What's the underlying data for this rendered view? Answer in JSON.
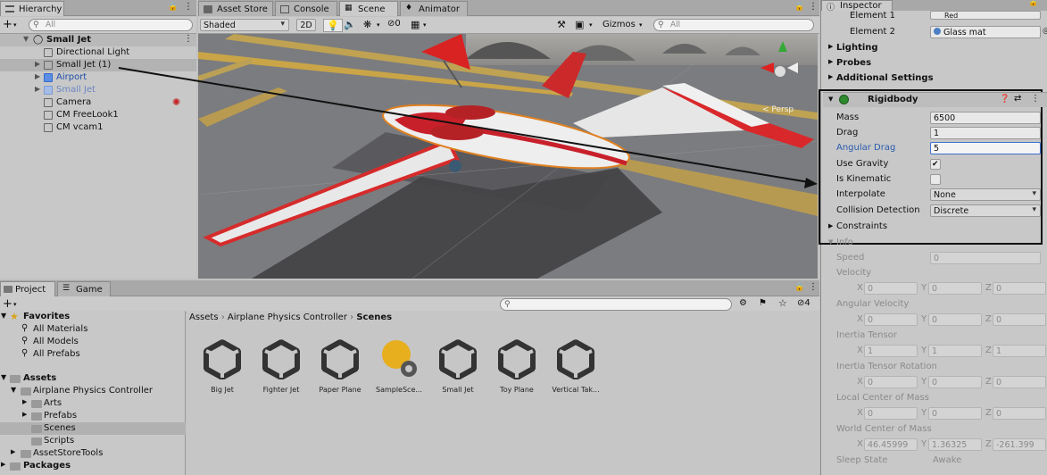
{
  "hierarchy": {
    "tab": "Hierarchy",
    "search_placeholder": "All",
    "add": "+",
    "root": "Small Jet",
    "items": [
      {
        "label": "Directional Light"
      },
      {
        "label": "Small Jet (1)"
      },
      {
        "label": "Airport"
      },
      {
        "label": "Small Jet"
      },
      {
        "label": "Camera"
      },
      {
        "label": "CM FreeLook1"
      },
      {
        "label": "CM vcam1"
      }
    ]
  },
  "scene_tabs": {
    "asset_store": "Asset Store",
    "console": "Console",
    "scene": "Scene",
    "animator": "Animator"
  },
  "scene_toolbar": {
    "shading": "Shaded",
    "mode_2d": "2D",
    "fx_count": "0",
    "gizmos": "Gizmos",
    "search_placeholder": "All",
    "persp": "< Persp"
  },
  "project": {
    "tab_project": "Project",
    "tab_game": "Game",
    "add": "+",
    "hidden_count": "4",
    "breadcrumb": [
      "Assets",
      "Airplane Physics Controller",
      "Scenes"
    ],
    "favorites": {
      "label": "Favorites",
      "items": [
        "All Materials",
        "All Models",
        "All Prefabs"
      ]
    },
    "assets": {
      "label": "Assets",
      "child": "Airplane Physics Controller",
      "folders": [
        "Arts",
        "Prefabs",
        "Scenes",
        "Scripts"
      ],
      "other": "AssetStoreTools"
    },
    "packages": "Packages",
    "files": [
      "Big Jet",
      "Fighter Jet",
      "Paper Plane",
      "SampleSce...",
      "Small Jet",
      "Toy Plane",
      "Vertical Tak..."
    ]
  },
  "inspector": {
    "tab": "Inspector",
    "element1_label": "Element 1",
    "element1_value": "Red",
    "element2_label": "Element 2",
    "element2_value": "Glass mat",
    "sections": [
      "Lighting",
      "Probes",
      "Additional Settings"
    ],
    "rigidbody": {
      "title": "Rigidbody",
      "mass_label": "Mass",
      "mass": "6500",
      "drag_label": "Drag",
      "drag": "1",
      "angular_drag_label": "Angular Drag",
      "angular_drag": "5",
      "use_gravity_label": "Use Gravity",
      "use_gravity": "✔",
      "is_kinematic_label": "Is Kinematic",
      "interpolate_label": "Interpolate",
      "interpolate": "None",
      "collision_label": "Collision Detection",
      "collision": "Discrete",
      "constraints_label": "Constraints"
    },
    "info": {
      "label": "Info",
      "speed_label": "Speed",
      "speed": "0",
      "velocity_label": "Velocity",
      "velocity": [
        "0",
        "0",
        "0"
      ],
      "angular_velocity_label": "Angular Velocity",
      "angular_velocity": [
        "0",
        "0",
        "0"
      ],
      "inertia_tensor_label": "Inertia Tensor",
      "inertia_tensor": [
        "1",
        "1",
        "1"
      ],
      "inertia_rotation_label": "Inertia Tensor Rotation",
      "inertia_rotation": [
        "0",
        "0",
        "0"
      ],
      "local_com_label": "Local Center of Mass",
      "local_com": [
        "0",
        "0",
        "0"
      ],
      "world_com_label": "World Center of Mass",
      "world_com": [
        "46.45999",
        "1.36325",
        "-261.399"
      ],
      "sleep_label": "Sleep State",
      "sleep": "Awake"
    },
    "axes": [
      "X",
      "Y",
      "Z"
    ]
  }
}
